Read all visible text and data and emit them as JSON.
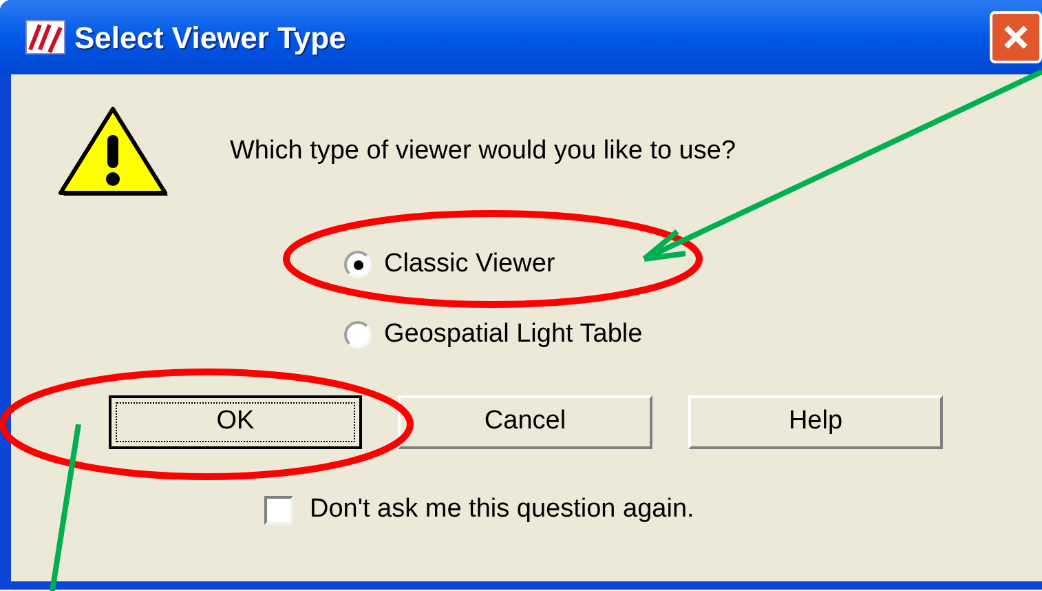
{
  "window": {
    "title": "Select Viewer Type"
  },
  "question": "Which type of viewer would you like to use?",
  "options": [
    {
      "label": "Classic Viewer",
      "selected": true
    },
    {
      "label": "Geospatial Light Table",
      "selected": false
    }
  ],
  "buttons": [
    {
      "label": "OK",
      "focused": true
    },
    {
      "label": "Cancel",
      "focused": false
    },
    {
      "label": "Help",
      "focused": false
    }
  ],
  "dont_ask": {
    "label": "Don't ask me this question again.",
    "checked": false
  }
}
